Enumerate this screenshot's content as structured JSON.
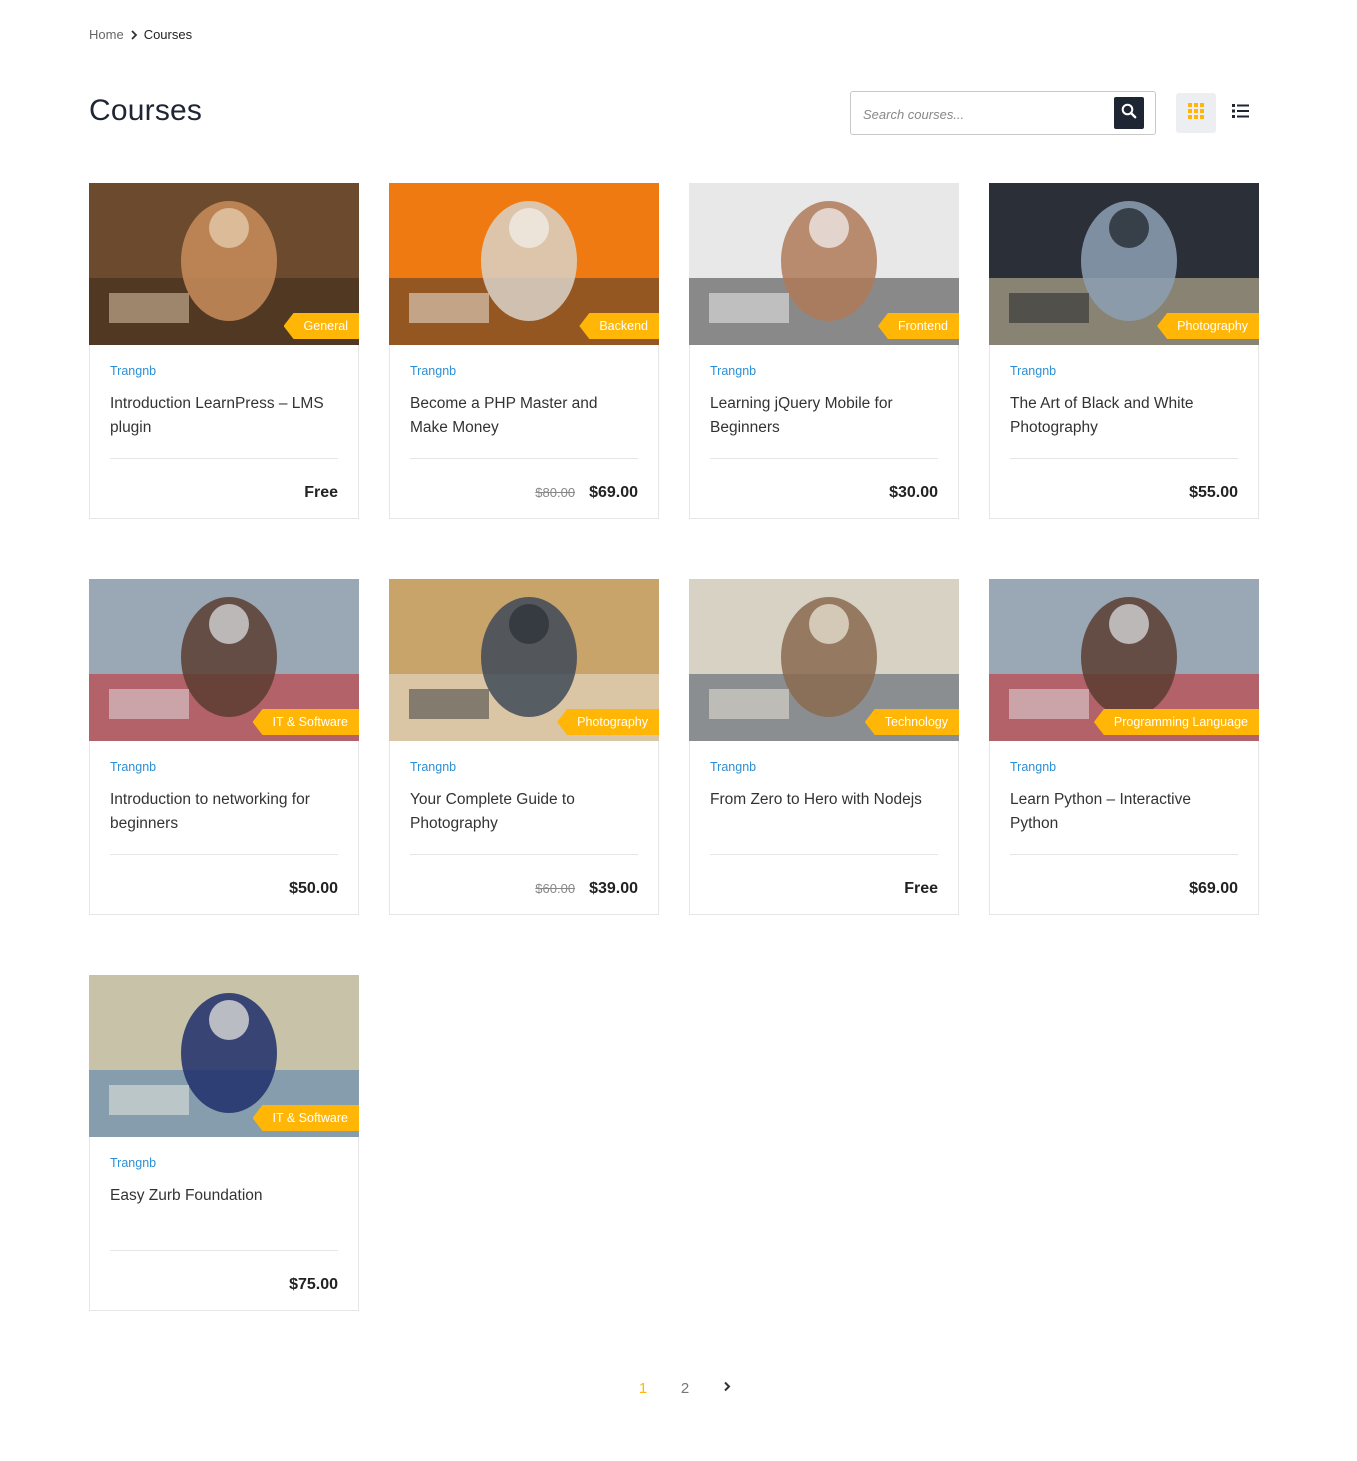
{
  "breadcrumb": {
    "home": "Home",
    "current": "Courses"
  },
  "page": {
    "title": "Courses"
  },
  "search": {
    "placeholder": "Search courses..."
  },
  "icons": {
    "search": "search-icon",
    "grid": "grid-view-icon",
    "list": "list-view-icon",
    "separator": "chevron-right-icon",
    "next": "chevron-right-icon"
  },
  "colors": {
    "accent": "#ffb606",
    "dark": "#1f2633",
    "author": "#2d8fd5"
  },
  "courses": [
    {
      "category": "General",
      "author": "Trangnb",
      "title": "Introduction LearnPress – LMS plugin",
      "old_price": "",
      "price": "Free"
    },
    {
      "category": "Backend",
      "author": "Trangnb",
      "title": "Become a PHP Master and Make Money",
      "old_price": "$80.00",
      "price": "$69.00"
    },
    {
      "category": "Frontend",
      "author": "Trangnb",
      "title": "Learning jQuery Mobile for Beginners",
      "old_price": "",
      "price": "$30.00"
    },
    {
      "category": "Photography",
      "author": "Trangnb",
      "title": "The Art of Black and White Photography",
      "old_price": "",
      "price": "$55.00"
    },
    {
      "category": "IT & Software",
      "author": "Trangnb",
      "title": "Introduction to networking for beginners",
      "old_price": "",
      "price": "$50.00"
    },
    {
      "category": "Photography",
      "author": "Trangnb",
      "title": "Your Complete Guide to Photography",
      "old_price": "$60.00",
      "price": "$39.00"
    },
    {
      "category": "Technology",
      "author": "Trangnb",
      "title": "From Zero to Hero with Nodejs",
      "old_price": "",
      "price": "Free"
    },
    {
      "category": "Programming Language",
      "author": "Trangnb",
      "title": "Learn Python – Interactive Python",
      "old_price": "",
      "price": "$69.00"
    },
    {
      "category": "IT & Software",
      "author": "Trangnb",
      "title": "Easy Zurb Foundation",
      "old_price": "",
      "price": "$75.00"
    }
  ],
  "pagination": {
    "pages": [
      "1",
      "2"
    ],
    "current": "1"
  }
}
